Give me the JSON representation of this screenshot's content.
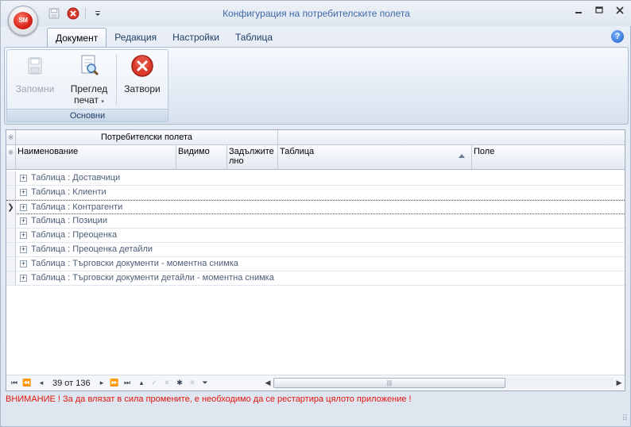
{
  "window": {
    "title": "Конфигурация на потребителските полета",
    "app_logo_text": "SM"
  },
  "quick_access": [
    {
      "name": "save-icon"
    },
    {
      "name": "close-icon"
    },
    {
      "name": "customize-dropdown-icon"
    }
  ],
  "ribbon": {
    "tabs": [
      "Документ",
      "Редакция",
      "Настройки",
      "Таблица"
    ],
    "active_tab": "Документ",
    "group": {
      "label": "Основни",
      "buttons": [
        {
          "label": "Запомни",
          "icon": "save-icon",
          "enabled": false
        },
        {
          "label_line1": "Преглед",
          "label_line2": "печат",
          "icon": "print-preview-icon",
          "enabled": true
        },
        {
          "label": "Затвори",
          "icon": "close-icon",
          "enabled": true
        }
      ]
    }
  },
  "grid": {
    "band_header": "Потребителски полета",
    "columns": [
      "Наименование",
      "Видимо",
      "Задължите\nлно",
      "Таблица",
      "Поле"
    ],
    "rows": [
      "Таблица : Доставчици",
      "Таблица : Клиенти",
      "Таблица : Контрагенти",
      "Таблица : Позиции",
      "Таблица : Преоценка",
      "Таблица : Преоценка детайли",
      "Таблица : Търговски документи - моментна снимка",
      "Таблица : Търговски документи детайли - моментна снимка"
    ],
    "current_row_index": 2,
    "navigator": {
      "position_text": "39 от 136"
    }
  },
  "warning": "ВНИМАНИЕ ! За да влязат в сила промените,  е необходимо да се рестартира цялото приложение !",
  "colors": {
    "title": "#3e6aa6",
    "warning": "#e0150c",
    "row_text": "#4e5e78"
  }
}
